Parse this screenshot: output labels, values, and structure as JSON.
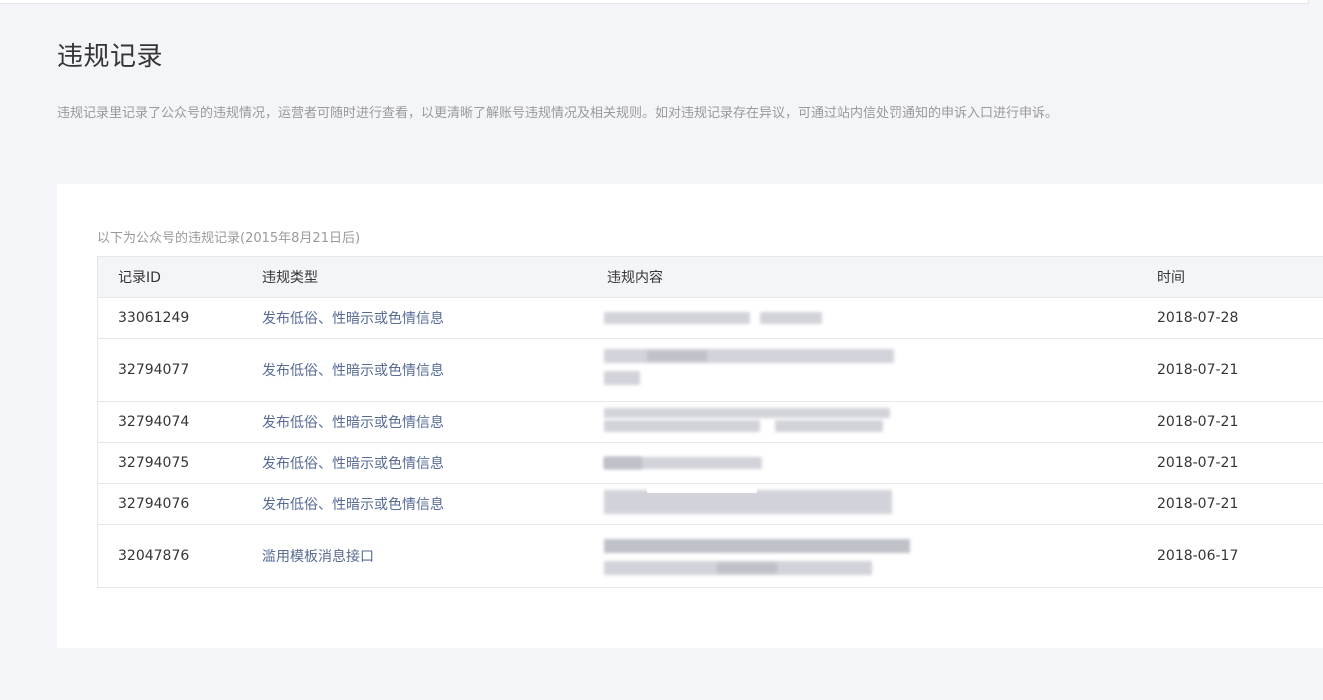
{
  "page": {
    "title": "违规记录",
    "description": "违规记录里记录了公众号的违规情况，运营者可随时进行查看，以更清晰了解账号违规情况及相关规则。如对违规记录存在异议，可通过站内信处罚通知的申诉入口进行申诉。"
  },
  "table": {
    "caption": "以下为公众号的违规记录(2015年8月21日后)",
    "columns": {
      "id": "记录ID",
      "type": "违规类型",
      "content": "违规内容",
      "time": "时间"
    },
    "rows": [
      {
        "id": "33061249",
        "type": "发布低俗、性暗示或色情信息",
        "content_note": "blurred",
        "time": "2018-07-28"
      },
      {
        "id": "32794077",
        "type": "发布低俗、性暗示或色情信息",
        "content_note": "blurred",
        "time": "2018-07-21"
      },
      {
        "id": "32794074",
        "type": "发布低俗、性暗示或色情信息",
        "content_note": "blurred",
        "time": "2018-07-21"
      },
      {
        "id": "32794075",
        "type": "发布低俗、性暗示或色情信息",
        "content_note": "blurred",
        "time": "2018-07-21"
      },
      {
        "id": "32794076",
        "type": "发布低俗、性暗示或色情信息",
        "content_note": "blurred",
        "time": "2018-07-21"
      },
      {
        "id": "32047876",
        "type": "滥用模板消息接口",
        "content_note": "blurred",
        "time": "2018-06-17"
      }
    ]
  },
  "colors": {
    "background": "#f4f5f9",
    "link": "#576b95",
    "muted_text": "#9a9a9a"
  }
}
